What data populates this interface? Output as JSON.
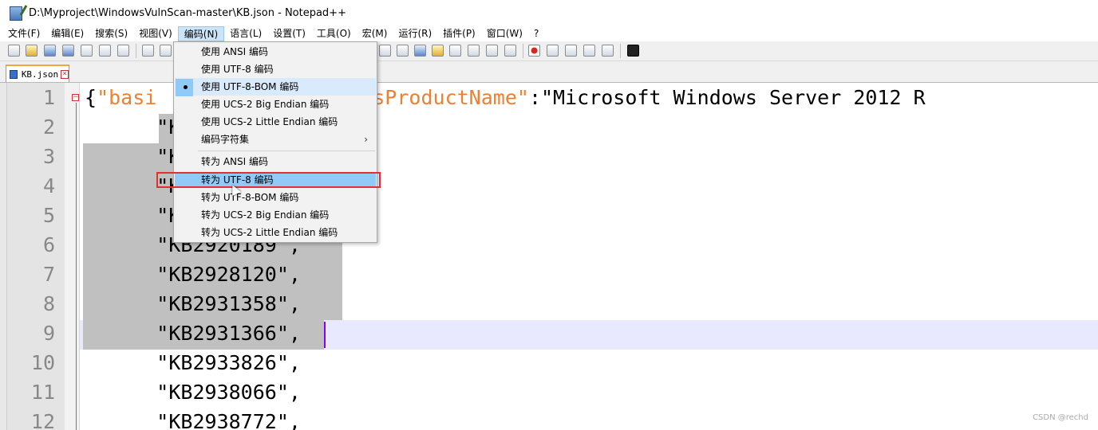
{
  "window": {
    "title": "D:\\Myproject\\WindowsVulnScan-master\\KB.json - Notepad++"
  },
  "menubar": {
    "items": [
      "文件(F)",
      "编辑(E)",
      "搜索(S)",
      "视图(V)",
      "编码(N)",
      "语言(L)",
      "设置(T)",
      "工具(O)",
      "宏(M)",
      "运行(R)",
      "插件(P)",
      "窗口(W)",
      "?"
    ],
    "active_index": 4
  },
  "tab": {
    "label": "KB.json",
    "close": "×"
  },
  "encoding_menu": {
    "items": [
      "使用 ANSI 编码",
      "使用 UTF-8 编码",
      "使用 UTF-8-BOM 编码",
      "使用 UCS-2 Big Endian 编码",
      "使用 UCS-2 Little Endian 编码",
      "编码字符集",
      "转为 ANSI 编码",
      "转为 UTF-8 编码",
      "转为 UTF-8-BOM 编码",
      "转为 UCS-2 Big Endian 编码",
      "转为 UCS-2 Little Endian 编码"
    ],
    "checked_item": "使用 UTF-8-BOM 编码",
    "highlighted_item": "转为 UTF-8 编码",
    "submenu_arrow": "›"
  },
  "editor": {
    "line_numbers": [
      "1",
      "2",
      "3",
      "4",
      "5",
      "6",
      "7",
      "8",
      "9",
      "10",
      "11",
      "12"
    ],
    "fold_marker": "−",
    "lines": [
      {
        "prefix": "{",
        "key": "\"basi",
        "mid": "                ",
        "key2": "owsProductName\"",
        "rest": ":\"Microsoft Windows Server 2012 R"
      },
      {
        "text": "      \"K"
      },
      {
        "text": "      \"K"
      },
      {
        "text": "      \"K"
      },
      {
        "text": "      \"K"
      },
      {
        "text": "      \"KB2920189\","
      },
      {
        "text": "      \"KB2928120\","
      },
      {
        "text": "      \"KB2931358\","
      },
      {
        "text": "      \"KB2931366\","
      },
      {
        "text": "      \"KB2933826\","
      },
      {
        "text": "      \"KB2938066\","
      },
      {
        "text": "      \"KB2938772\","
      }
    ]
  },
  "watermark": "CSDN @rechd"
}
